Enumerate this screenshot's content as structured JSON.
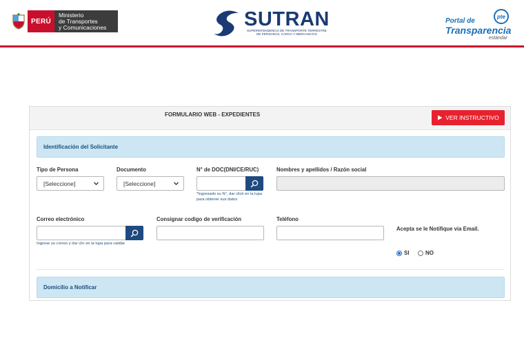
{
  "header": {
    "peru_label": "PERÚ",
    "ministry_lines": [
      "Ministerio",
      "de Transportes",
      "y Comunicaciones"
    ],
    "sutran_logo": "SUTRAN",
    "sutran_sub_lines": [
      "SUPERINTENDENCIA DE TRANSPORTE TERRESTRE",
      "DE PERSONAS, CARGA Y MERCANCÍAS"
    ],
    "portal_de": "Portal de",
    "transparencia": "Transparencia",
    "estandar": "estándar",
    "pte_badge": "pte",
    "accent_color": "#c8102e",
    "brand_color": "#1b3a73"
  },
  "form": {
    "title": "FORMULARIO WEB - EXPEDIENTES",
    "instructivo_button": "VER INSTRUCTIVO",
    "section_identificacion": "Identificación del Solicitante",
    "section_domicilio": "Domicilio a Notificar",
    "tipo_persona_label": "Tipo de Persona",
    "tipo_persona_value": "[Seleccione]",
    "documento_label": "Documento",
    "documento_value": "[Seleccione]",
    "ndoc_label": "N° de DOC(DNI/CE/RUC)",
    "ndoc_value": "",
    "ndoc_hint": "*Ingresado su N°, dar click en la lupa para obtener sus datos",
    "nombres_label": "Nombres y apellidos / Razón social",
    "nombres_value": "",
    "correo_label": "Correo electrónico",
    "correo_value": "",
    "correo_hint": "Ingrese su correo y dar clic en la lupa para validar",
    "codigo_label": "Consignar codigo de verificación",
    "codigo_value": "",
    "telefono_label": "Teléfono",
    "telefono_value": "",
    "notifique_label": "Acepta se le Notifique via Email.",
    "radio_si": "SI",
    "radio_no": "NO",
    "radio_selected": "SI"
  }
}
